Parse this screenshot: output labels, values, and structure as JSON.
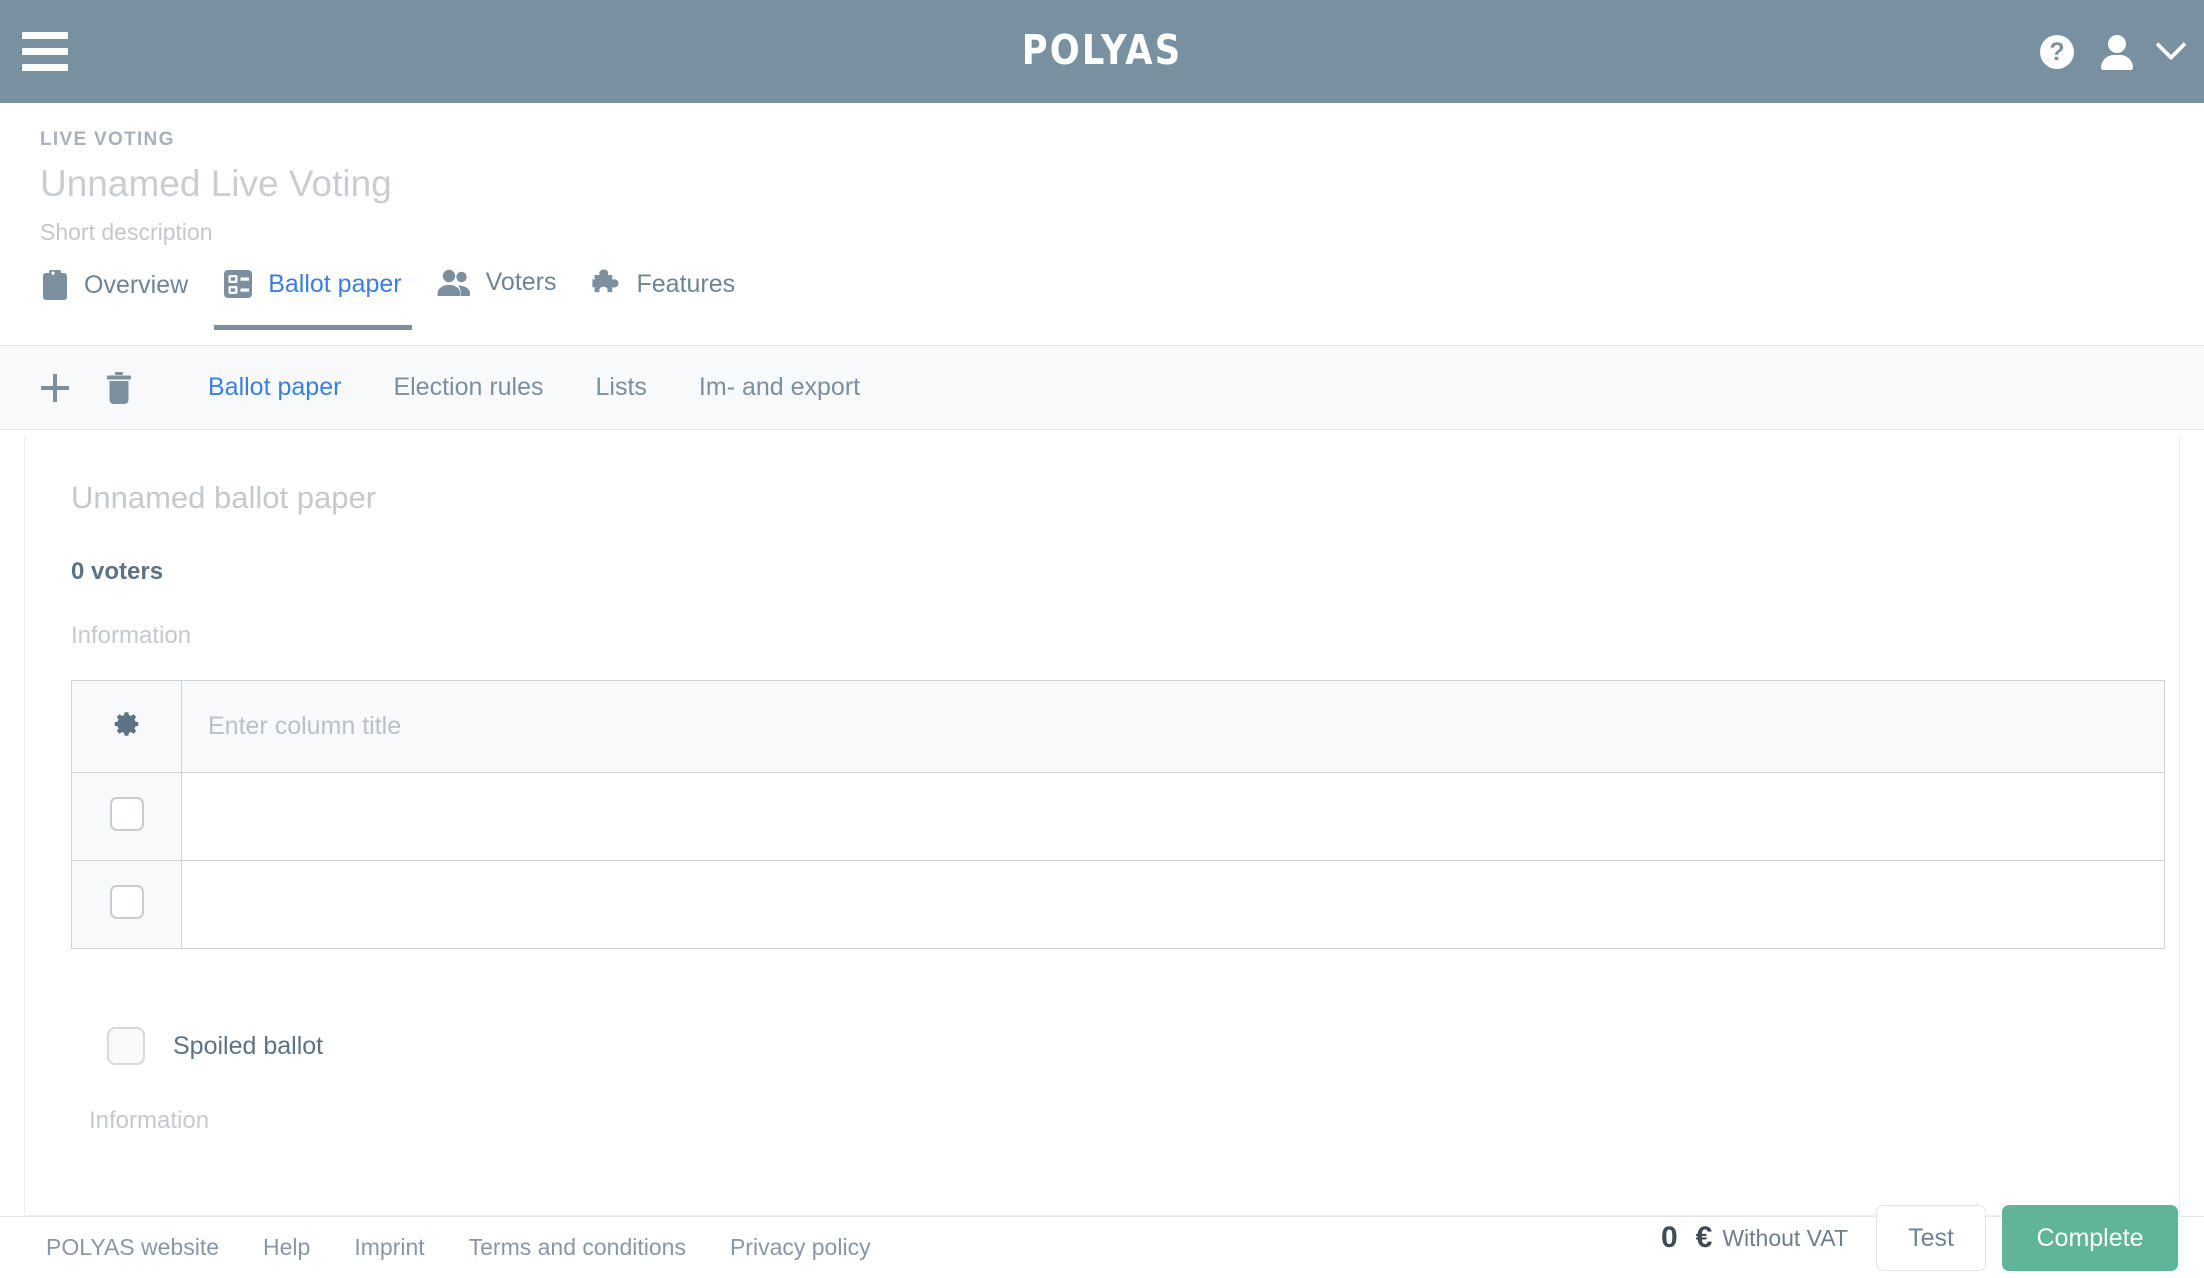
{
  "topbar": {
    "brand": "POLYAS",
    "menu_icon": "hamburger-menu-icon",
    "help_icon": "?",
    "user_icon": "user-account-icon",
    "chevron_icon": "chevron-down-icon"
  },
  "header": {
    "kicker": "LIVE VOTING",
    "title": "Unnamed Live Voting",
    "subtitle": "Short description"
  },
  "tabs": [
    {
      "label": "Overview",
      "icon": "clipboard-icon",
      "active": false
    },
    {
      "label": "Ballot paper",
      "icon": "ballot-paper-icon",
      "active": true
    },
    {
      "label": "Voters",
      "icon": "people-icon",
      "active": false
    },
    {
      "label": "Features",
      "icon": "puzzle-piece-icon",
      "active": false
    }
  ],
  "subnav": {
    "add_icon": "plus-icon",
    "delete_icon": "trash-icon",
    "links": [
      {
        "label": "Ballot paper",
        "active": true
      },
      {
        "label": "Election rules",
        "active": false
      },
      {
        "label": "Lists",
        "active": false
      },
      {
        "label": "Im- and export",
        "active": false
      }
    ]
  },
  "content": {
    "ballot_name_placeholder": "Unnamed ballot paper",
    "voters_count": "0 voters",
    "information_label": "Information",
    "table": {
      "gear_icon": "gear-icon",
      "column_title_placeholder": "Enter column title",
      "rows": [
        {
          "checked": false,
          "value": ""
        },
        {
          "checked": false,
          "value": ""
        }
      ]
    },
    "spoiled_ballot": {
      "label": "Spoiled ballot",
      "checked": false
    },
    "information_label_2": "Information"
  },
  "footer": {
    "links": [
      "POLYAS website",
      "Help",
      "Imprint",
      "Terms and conditions",
      "Privacy policy"
    ],
    "price_amount": "0",
    "price_currency": "€",
    "price_vat": "Without VAT",
    "test_button": "Test",
    "complete_button": "Complete"
  },
  "colors": {
    "topbar": "#78909f",
    "accent_blue": "#3b7fe0",
    "complete_green": "#5fb597",
    "muted_text": "#6f8494"
  }
}
